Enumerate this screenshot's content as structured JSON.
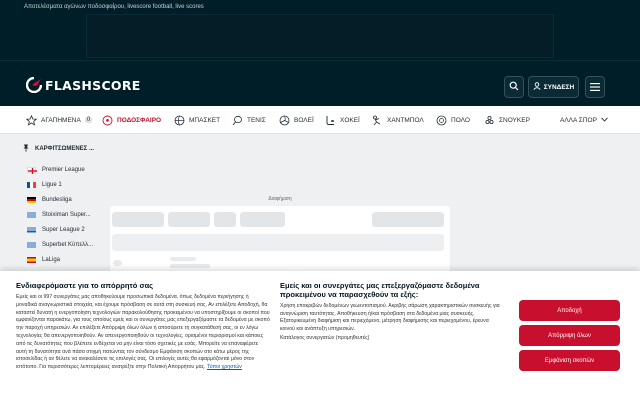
{
  "topbar": {
    "description": "Αποτελέσματα αγώνων ποδοσφαίρου, livescore football, live scores"
  },
  "header": {
    "logo_text": "FLASHSCORE",
    "login_label": "ΣΥΝΔΕΣΗ"
  },
  "sports": {
    "favorites": "ΑΓΑΠΗΜΕΝΑ",
    "favorites_count": "0",
    "items": [
      "ΠΟΔΟΣΦΑΙΡΟ",
      "ΜΠΑΣΚΕΤ",
      "ΤΕΝΙΣ",
      "ΒΟΛΕΪ",
      "ΧΟΚΕΪ",
      "ΧΑΝΤΜΠΟΛ",
      "ΠΟΛΟ",
      "ΣΝΟΥΚΕΡ"
    ],
    "other": "ΑΛΛΑ ΣΠΟΡ"
  },
  "pinned": {
    "title": "ΚΑΡΦΙΤΣΩΜΕΝΕΣ ...",
    "leagues": [
      "Premier League",
      "Ligue 1",
      "Bundesliga",
      "Stoiximan Super...",
      "Super League 2",
      "Superbet Κύπελλ...",
      "LaLiga"
    ]
  },
  "main": {
    "ad_label": "Διαφήμιση"
  },
  "cookie": {
    "left_title": "Ενδιαφερόμαστε για το απόρρητό σας",
    "left_body": "Εμείς και οι 997 συνεργάτες μας αποθηκεύουμε προσωπικά δεδομένα, όπως δεδομένα περιήγησης ή μοναδικά αναγνωριστικά στοιχεία, και έχουμε πρόσβαση σε αυτά στη συσκευή σας. Αν επιλέξετε Αποδοχή, θα καταστεί δυνατή η ενεργοποίηση τεχνολογιών παρακολούθησης προκειμένου να υποστηρίξουμε οι σκοποί που εμφανίζονται παρακάτω, για τους οποίους εμείς και οι συνεργάτες μας επεξεργαζόμαστε τα δεδομένα με σκοπό την παροχή υπηρεσιών. Αν επιλέξετε Απόρριψη όλων όλων ή αποσύρετε τη συγκατάθεσή σας, οι εν λόγω τεχνολογίες θα απενεργοποιηθούν. Αν απενεργοποιηθούν οι τεχνολογίες, ορισμένοι περιορισμοί και κάποιες από τις δυνατότητες που βλέπετε ενδέχεται να μην είναι τόσο σχετικές με εσάς. Μπορείτε να επαναφέρετε αυτή τη δυνατότητα ανά πάσα στιγμή πατώντας τον σύνδεσμο Εμφάνιση σκοπών στο κάτω μέρος της ιστοσελίδας ή αν θέλετε να ανακαλέσετε τις επιλογές σας. Οι επιλογές αυτές θα εφαρμόζονται μόνο στον ιστότοπο. Για περισσότερες λεπτομέρειες ανατρέξτε στην Πολιτική Απορρήτου μας.",
    "left_link": "Τύποι χρηστών",
    "count": "997",
    "right_title": "Εμείς και οι συνεργάτες μας επεξεργαζόμαστε δεδομένα προκειμένου να παρασχεθούν τα εξής:",
    "right_body": "Χρήση επακριβών δεδομένων γεωεντοπισμού. Ακριβής σάρωση χαρακτηριστικών συσκευής για αναγνώριση ταυτότητας. Αποθήκευση ή/και πρόσβαση στα δεδομένα μιας συσκευής. Εξατομικευμένη διαφήμιση και περιεχόμενο, μέτρηση διαφήμισης και περιεχομένου, έρευνα κοινού και ανάπτυξη υπηρεσιών.",
    "right_partners": "Κατάλογος συνεργατών (προμηθευτές)",
    "accept": "Αποδοχή",
    "reject": "Απόρριψη όλων",
    "purposes": "Εμφάνιση σκοπών"
  },
  "colors": {
    "brand_red": "#c8102e",
    "dark": "#001e28"
  }
}
